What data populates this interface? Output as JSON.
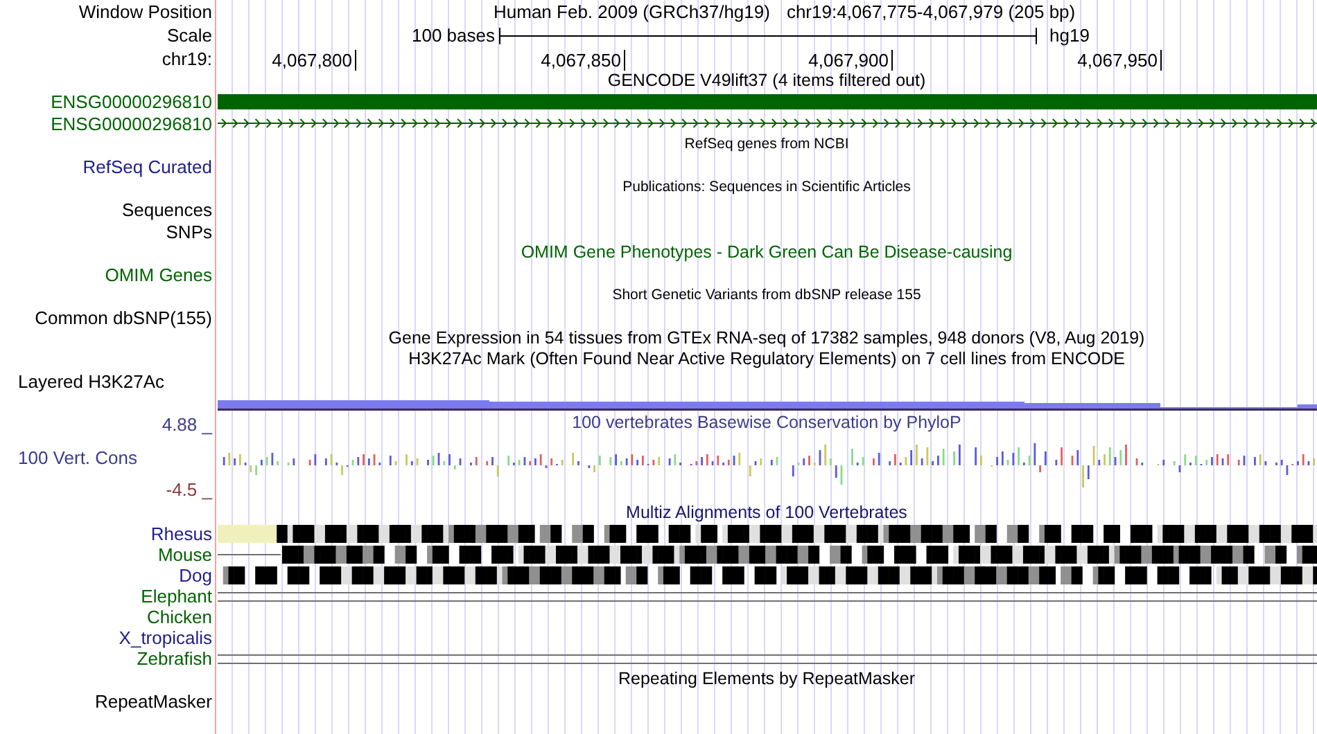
{
  "header": {
    "position_label": "Window Position",
    "assembly": "Human Feb. 2009 (GRCh37/hg19)",
    "position": "chr19:4,067,775-4,067,979 (205 bp)",
    "scale_label": "Scale",
    "scale_text": "100 bases",
    "scale_db": "hg19",
    "chrom_label": "chr19:",
    "ticks": [
      "4,067,800",
      "4,067,850",
      "4,067,900",
      "4,067,950"
    ]
  },
  "tracks": [
    {
      "kind": "title",
      "text": "GENCODE V49lift37 (4 items filtered out)",
      "color": "#000000"
    },
    {
      "kind": "gene_block",
      "label": "ENSG00000296810",
      "color": "#006400"
    },
    {
      "kind": "gene_arrows",
      "label": "ENSG00000296810",
      "color": "#006400"
    },
    {
      "kind": "small_title",
      "text": "RefSeq genes from NCBI"
    },
    {
      "kind": "label",
      "label": "RefSeq Curated",
      "color": "#20208c"
    },
    {
      "kind": "small_title",
      "text": "Publications: Sequences in Scientific Articles"
    },
    {
      "kind": "label",
      "label": "Sequences",
      "color": "#000000"
    },
    {
      "kind": "label",
      "label": "SNPs",
      "color": "#000000"
    },
    {
      "kind": "title",
      "text": "OMIM Gene Phenotypes - Dark Green Can Be Disease-causing",
      "color": "#006400"
    },
    {
      "kind": "label",
      "label": "OMIM Genes",
      "color": "#006400"
    },
    {
      "kind": "small_title",
      "text": "Short Genetic Variants from dbSNP release 155"
    },
    {
      "kind": "label",
      "label": "Common dbSNP(155)",
      "color": "#000000"
    },
    {
      "kind": "title",
      "text": "Gene Expression in 54 tissues from GTEx RNA-seq of 17382 samples, 948 donors (V8, Aug 2019)",
      "color": "#000000"
    },
    {
      "kind": "title",
      "text": "H3K27Ac Mark (Often Found Near Active Regulatory Elements) on 7 cell lines from ENCODE",
      "color": "#000000"
    },
    {
      "kind": "label_left",
      "label": "Layered H3K27Ac",
      "color": "#000000"
    },
    {
      "kind": "signal_bar"
    },
    {
      "kind": "wiggle",
      "title": "100 vertebrates Basewise Conservation by PhyloP",
      "label": "100 Vert. Cons",
      "max": "4.88 _",
      "min": "-4.5 _",
      "color": "#3c3c8c"
    },
    {
      "kind": "title",
      "text": "Multiz Alignments of 100 Vertebrates",
      "color": "#14146e"
    },
    {
      "kind": "alignment_blocks",
      "label": "Rhesus",
      "color": "#20208c",
      "unaligned_start": true,
      "gap_start": false
    },
    {
      "kind": "alignment_blocks",
      "label": "Mouse",
      "color": "#006400",
      "unaligned_start": false,
      "gap_start": true
    },
    {
      "kind": "alignment_blocks",
      "label": "Dog",
      "color": "#20208c",
      "unaligned_start": false,
      "gap_start": false
    },
    {
      "kind": "alignment_lines",
      "label": "Elephant",
      "color": "#006400"
    },
    {
      "kind": "alignment_empty",
      "label": "Chicken",
      "color": "#006400"
    },
    {
      "kind": "alignment_empty",
      "label": "X_tropicalis",
      "color": "#20208c"
    },
    {
      "kind": "alignment_lines",
      "label": "Zebrafish",
      "color": "#006400"
    },
    {
      "kind": "title",
      "text": "Repeating Elements by RepeatMasker",
      "color": "#000000"
    },
    {
      "kind": "label",
      "label": "RepeatMasker",
      "color": "#000000"
    }
  ]
}
